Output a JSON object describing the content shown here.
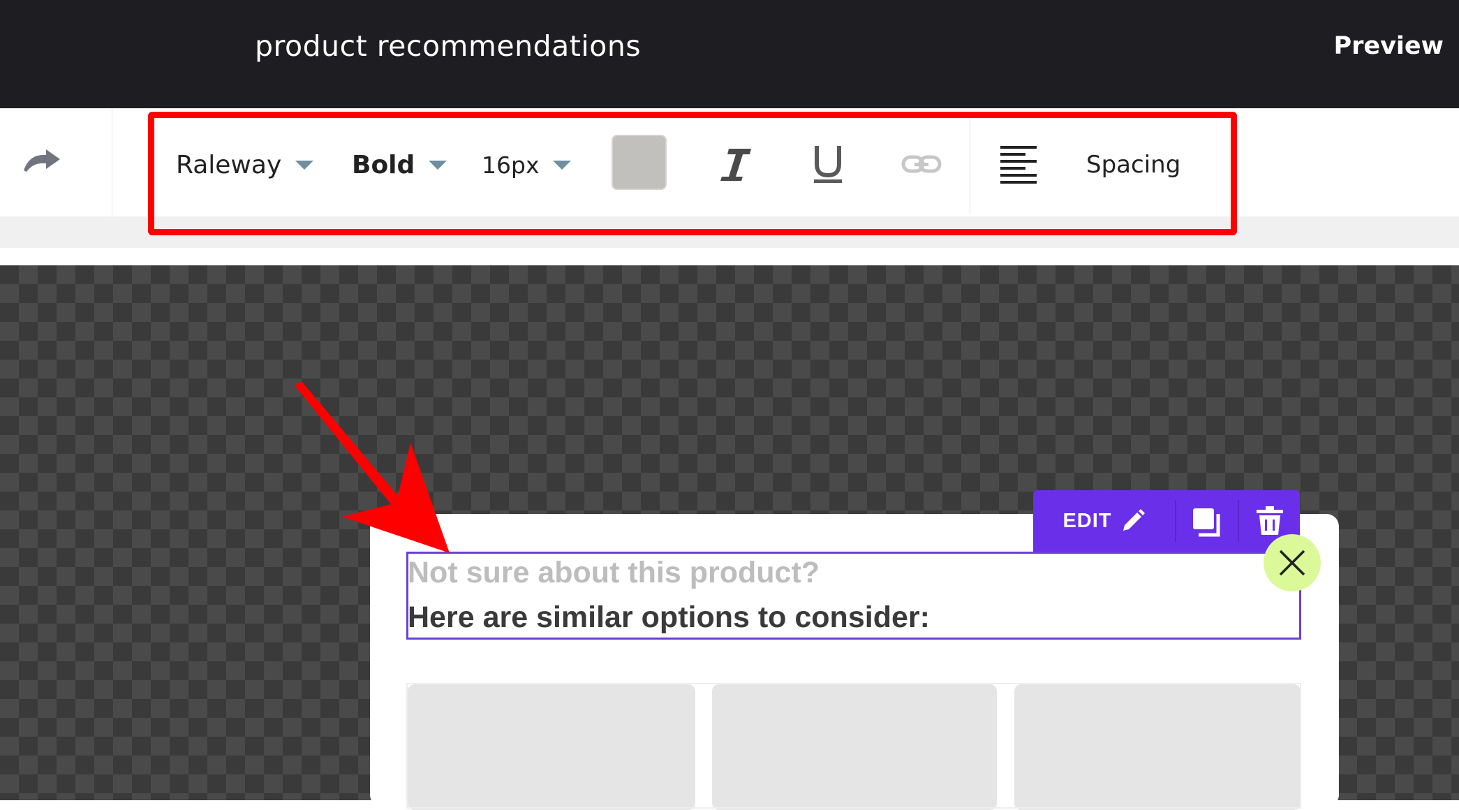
{
  "header": {
    "title": "product recommendations",
    "preview_label": "Preview"
  },
  "toolbar": {
    "font_family": "Raleway",
    "font_weight": "Bold",
    "font_size": "16px",
    "spacing_label": "Spacing",
    "text_color": "#c2c0bc"
  },
  "popup": {
    "headline_line1": "Not sure about this product?",
    "headline_line2": "Here are similar options to consider:",
    "edit_label": "EDIT"
  },
  "colors": {
    "accent": "#6a2fe8",
    "annotation": "#ff0000",
    "close_button": "#dcf99a"
  }
}
